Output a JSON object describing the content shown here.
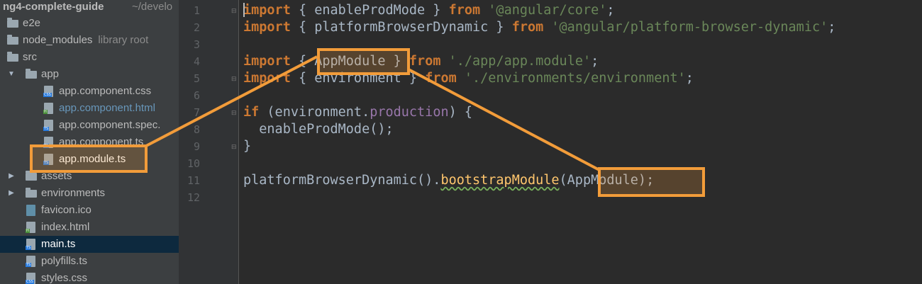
{
  "project": {
    "name": "ng4-complete-guide",
    "path": "~/develo"
  },
  "tree": [
    {
      "name": "e2e",
      "kind": "folder"
    },
    {
      "name": "node_modules",
      "kind": "folder",
      "hint": "library root"
    },
    {
      "name": "src",
      "kind": "folder"
    },
    {
      "name": "app",
      "kind": "folder",
      "expanded": true
    },
    {
      "name": "app.component.css",
      "kind": "file",
      "badge": "CSS"
    },
    {
      "name": "app.component.html",
      "kind": "file",
      "badge": "H"
    },
    {
      "name": "app.component.spec.",
      "kind": "file",
      "badge": "TS"
    },
    {
      "name": "app.component.ts",
      "kind": "file",
      "badge": "TS"
    },
    {
      "name": "app.module.ts",
      "kind": "file",
      "badge": "TS"
    },
    {
      "name": "assets",
      "kind": "folder",
      "collapsed": true
    },
    {
      "name": "environments",
      "kind": "folder",
      "collapsed": true
    },
    {
      "name": "favicon.ico",
      "kind": "file"
    },
    {
      "name": "index.html",
      "kind": "file",
      "badge": "H"
    },
    {
      "name": "main.ts",
      "kind": "file",
      "badge": "TS",
      "selected": true
    },
    {
      "name": "polyfills.ts",
      "kind": "file",
      "badge": "TS"
    },
    {
      "name": "styles.css",
      "kind": "file",
      "badge": "CSS"
    }
  ],
  "line_numbers": [
    "1",
    "2",
    "3",
    "4",
    "5",
    "6",
    "7",
    "8",
    "9",
    "10",
    "11",
    "12"
  ],
  "code": {
    "l1": {
      "kw1": "import",
      "t1": " { enableProdMode } ",
      "kw2": "from",
      "s1": " '@angular/core'",
      "t2": ";"
    },
    "l2": {
      "kw1": "import",
      "t1": " { platformBrowserDynamic } ",
      "kw2": "from",
      "s1": " '@angular/platform-browser-dynamic'",
      "t2": ";"
    },
    "l4": {
      "kw1": "import",
      "t1": " { ",
      "id": "AppModule",
      "t2": " } ",
      "kw2": "from",
      "s1": " './app/app.module'",
      "t3": ";"
    },
    "l5": {
      "kw1": "import",
      "t1": " { environment } ",
      "kw2": "from",
      "s1": " './environments/environment'",
      "t2": ";"
    },
    "l7": {
      "kw1": "if",
      "t1": " (environment.",
      "prop": "production",
      "t2": ") {"
    },
    "l8": {
      "t1": "  enableProdMode();"
    },
    "l9": {
      "t1": "}"
    },
    "l11": {
      "t1": "platformBrowserDynamic().",
      "fn": "bootstrapModule",
      "t2": "(AppModule)",
      "t3": ";"
    }
  },
  "colors": {
    "highlight": "#f29c3a",
    "keyword": "#cc7832",
    "string": "#6a8759",
    "property": "#9876aa",
    "method": "#ffc66d"
  }
}
